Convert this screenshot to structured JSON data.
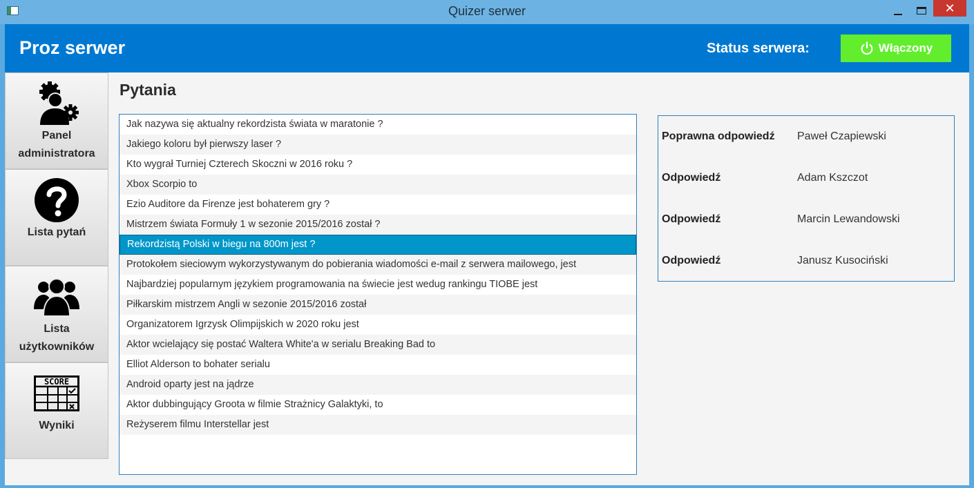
{
  "window": {
    "title": "Quizer serwer",
    "close_glyph": "✕"
  },
  "header": {
    "app_title": "Proz serwer",
    "status_label": "Status serwera:",
    "status_button": "Włączony",
    "status_icon": "power-icon",
    "colors": {
      "header_bg": "#0078d2",
      "status_on": "#62ee2d"
    }
  },
  "sidebar": {
    "items": [
      {
        "label_line1": "Panel",
        "label_line2": "administratora",
        "icon": "admin-gears-icon"
      },
      {
        "label_line1": "Lista pytań",
        "label_line2": "",
        "icon": "question-icon"
      },
      {
        "label_line1": "Lista",
        "label_line2": "użytkowników",
        "icon": "users-icon"
      },
      {
        "label_line1": "Wyniki",
        "label_line2": "",
        "icon": "score-board-icon",
        "icon_text": "SCORE"
      }
    ]
  },
  "main": {
    "page_title": "Pytania",
    "selected_index": 6,
    "questions": [
      "Jak nazywa się aktualny rekordzista świata w maratonie ?",
      "Jakiego koloru był pierwszy laser ?",
      "Kto wygrał Turniej Czterech Skoczni w 2016 roku ?",
      "Xbox Scorpio to",
      "Ezio Auditore da Firenze jest bohaterem gry ?",
      "Mistrzem świata Formuły 1 w sezonie 2015/2016 został ?",
      "Rekordzistą Polski w biegu na 800m jest ?",
      "Protokołem sieciowym wykorzystywanym do pobierania wiadomości e-mail z serwera mailowego, jest",
      "Najbardziej popularnym językiem programowania na świecie jest wedug rankingu TIOBE jest",
      "Piłkarskim mistrzem Angli w sezonie 2015/2016 został",
      "Organizatorem Igrzysk Olimpijskich w 2020 roku jest",
      "Aktor wcielający się postać Waltera White'a w serialu Breaking Bad to",
      "Elliot Alderson to bohater serialu",
      "Android oparty jest na jądrze",
      "Aktor dubbingujący Groota w filmie Strażnicy Galaktyki, to",
      "Reżyserem filmu Interstellar jest",
      ""
    ]
  },
  "answers": [
    {
      "label": "Poprawna odpowiedź",
      "value": "Paweł Czapiewski"
    },
    {
      "label": "Odpowiedź",
      "value": "Adam Kszczot"
    },
    {
      "label": "Odpowiedź",
      "value": "Marcin Lewandowski"
    },
    {
      "label": "Odpowiedź",
      "value": "Janusz Kusociński"
    }
  ]
}
